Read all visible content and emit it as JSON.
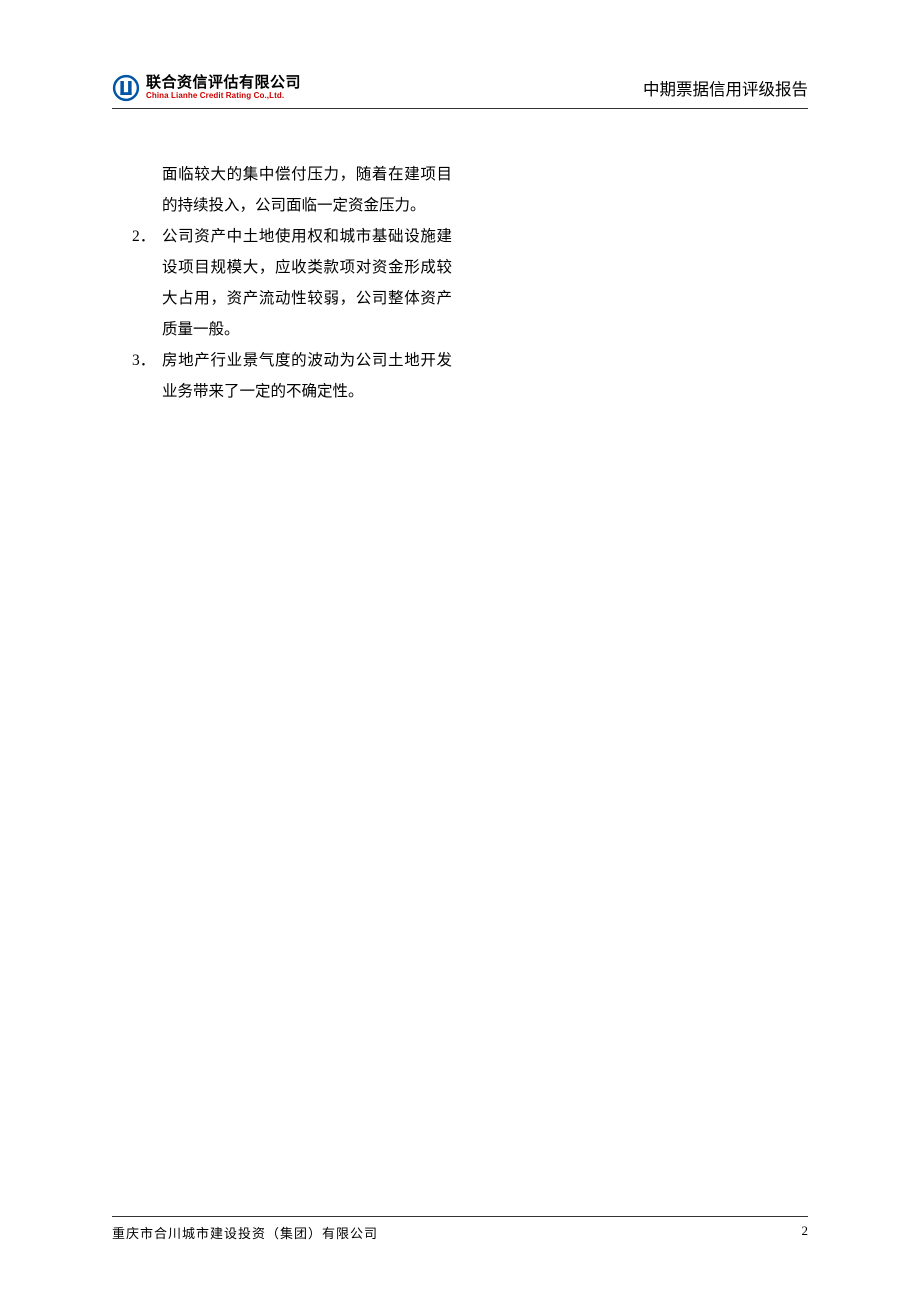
{
  "header": {
    "logo_cn": "联合资信评估有限公司",
    "logo_en": "China Lianhe Credit Rating Co.,Ltd.",
    "title": "中期票据信用评级报告"
  },
  "content": {
    "continuation": "面临较大的集中偿付压力，随着在建项目的持续投入，公司面临一定资金压力。",
    "items": [
      {
        "num": "2．",
        "text": "公司资产中土地使用权和城市基础设施建设项目规模大，应收类款项对资金形成较大占用，资产流动性较弱，公司整体资产质量一般。"
      },
      {
        "num": "3．",
        "text": "房地产行业景气度的波动为公司土地开发业务带来了一定的不确定性。"
      }
    ]
  },
  "footer": {
    "company": "重庆市合川城市建设投资（集团）有限公司",
    "page": "2"
  }
}
